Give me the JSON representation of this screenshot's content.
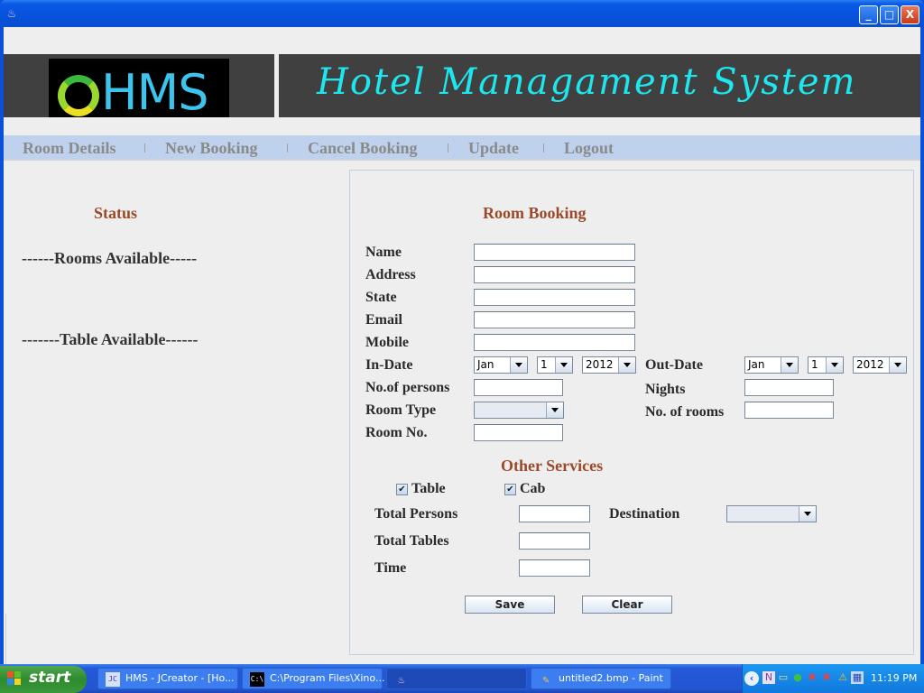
{
  "window": {
    "title": "",
    "controls": {
      "minimize": "_",
      "maximize": "□",
      "close": "X"
    }
  },
  "header": {
    "logo_text": "HMS",
    "app_title": "Hotel Managament System"
  },
  "menu": {
    "items": [
      {
        "label": "Room Details"
      },
      {
        "label": "New Booking"
      },
      {
        "label": "Cancel Booking"
      },
      {
        "label": "Update"
      },
      {
        "label": "Logout"
      }
    ]
  },
  "status_panel": {
    "title": "Status",
    "rooms_available": "------Rooms Available-----",
    "table_available": "-------Table Available------"
  },
  "booking": {
    "title": "Room Booking",
    "fields": {
      "name": {
        "label": "Name",
        "value": ""
      },
      "address": {
        "label": "Address",
        "value": ""
      },
      "state": {
        "label": "State",
        "value": ""
      },
      "email": {
        "label": "Email",
        "value": ""
      },
      "mobile": {
        "label": "Mobile",
        "value": ""
      },
      "in_date": {
        "label": "In-Date",
        "month": "Jan",
        "day": "1",
        "year": "2012"
      },
      "out_date": {
        "label": "Out-Date",
        "month": "Jan",
        "day": "1",
        "year": "2012"
      },
      "persons": {
        "label": "No.of persons",
        "value": ""
      },
      "nights": {
        "label": "Nights",
        "value": ""
      },
      "room_type": {
        "label": "Room Type",
        "value": ""
      },
      "rooms": {
        "label": "No. of rooms",
        "value": ""
      },
      "room_no": {
        "label": "Room No.",
        "value": ""
      }
    }
  },
  "other_services": {
    "title": "Other Services",
    "table_checkbox": {
      "label": "Table",
      "checked": true
    },
    "cab_checkbox": {
      "label": "Cab",
      "checked": true
    },
    "total_persons": {
      "label": "Total Persons",
      "value": ""
    },
    "destination": {
      "label": "Destination",
      "value": ""
    },
    "total_tables": {
      "label": "Total Tables",
      "value": ""
    },
    "time": {
      "label": "Time",
      "value": ""
    }
  },
  "buttons": {
    "save": "Save",
    "clear": "Clear"
  },
  "taskbar": {
    "start_label": "start",
    "tasks": [
      {
        "label": "HMS - JCreator - [Ho...",
        "icon": "jcreator-icon"
      },
      {
        "label": "C:\\Program Files\\Xino...",
        "icon": "cmd-icon"
      },
      {
        "label": "",
        "icon": "java-icon",
        "active": true
      },
      {
        "label": "untitled2.bmp - Paint",
        "icon": "paint-icon"
      }
    ],
    "clock": "11:19 PM"
  }
}
